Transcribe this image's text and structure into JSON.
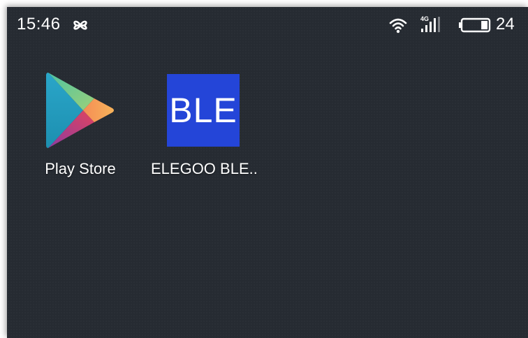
{
  "status_bar": {
    "time": "15:46",
    "notification_icon": "cloverleaf-icon",
    "wifi_icon": "wifi-icon",
    "network_type": "4G",
    "signal_icon": "cell-signal-icon",
    "battery_icon": "battery-icon",
    "battery_level": "24"
  },
  "home_screen": {
    "apps": [
      {
        "label": "Play Store",
        "icon": "play-store-icon"
      },
      {
        "label": "ELEGOO BLE..",
        "icon": "ble-app-icon",
        "icon_text": "BLE",
        "icon_color": "#2445d8"
      }
    ]
  },
  "colors": {
    "background": "#262b32",
    "text": "#ffffff"
  }
}
